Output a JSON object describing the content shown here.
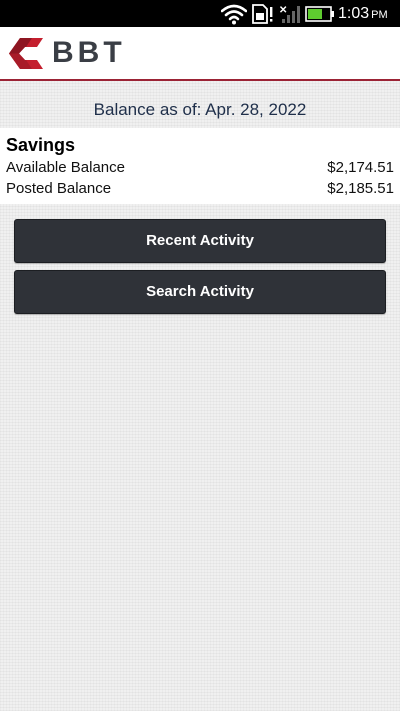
{
  "status_bar": {
    "time": "1:03",
    "ampm": "PM",
    "icons": [
      "wifi-icon",
      "sim-alert-icon",
      "signal-icon",
      "battery-icon"
    ]
  },
  "header": {
    "brand": "BBT",
    "brand_color": "#9b2335",
    "accent_color": "#3a3e45"
  },
  "balance_date": "Balance as of: Apr. 28, 2022",
  "account": {
    "name": "Savings",
    "rows": [
      {
        "label": "Available Balance",
        "value": "$2,174.51"
      },
      {
        "label": "Posted Balance",
        "value": "$2,185.51"
      }
    ]
  },
  "actions": {
    "recent_activity": "Recent Activity",
    "search_activity": "Search Activity"
  }
}
